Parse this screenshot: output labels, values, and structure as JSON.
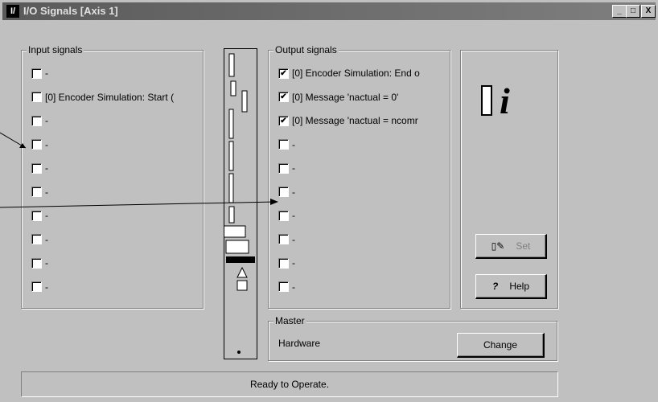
{
  "window": {
    "title": "I/O Signals [Axis 1]",
    "icon_text": "I/",
    "minimize": "_",
    "maximize": "□",
    "close": "X"
  },
  "input_group": {
    "title": "Input signals",
    "items": [
      {
        "label": "-",
        "checked": false
      },
      {
        "label": "[0] Encoder Simulation: Start (",
        "checked": false
      },
      {
        "label": "-",
        "checked": false
      },
      {
        "label": "-",
        "checked": false
      },
      {
        "label": "-",
        "checked": false
      },
      {
        "label": "-",
        "checked": false
      },
      {
        "label": "-",
        "checked": false
      },
      {
        "label": "-",
        "checked": false
      },
      {
        "label": "-",
        "checked": false
      },
      {
        "label": "-",
        "checked": false
      }
    ]
  },
  "output_group": {
    "title": "Output signals",
    "items": [
      {
        "label": "[0] Encoder Simulation: End o",
        "checked": true
      },
      {
        "label": "[0] Message 'nactual = 0'",
        "checked": true
      },
      {
        "label": "[0] Message 'nactual = ncomr",
        "checked": true
      },
      {
        "label": "-",
        "checked": false
      },
      {
        "label": "-",
        "checked": false
      },
      {
        "label": "-",
        "checked": false
      },
      {
        "label": "-",
        "checked": false
      },
      {
        "label": "-",
        "checked": false
      },
      {
        "label": "-",
        "checked": false
      },
      {
        "label": "-",
        "checked": false
      }
    ]
  },
  "info_panel": {
    "set_label": "Set",
    "help_label": "Help",
    "help_icon": "?"
  },
  "master": {
    "title": "Master",
    "value": "Hardware",
    "change_label": "Change"
  },
  "status": "Ready to Operate.",
  "check_mark": "✔"
}
